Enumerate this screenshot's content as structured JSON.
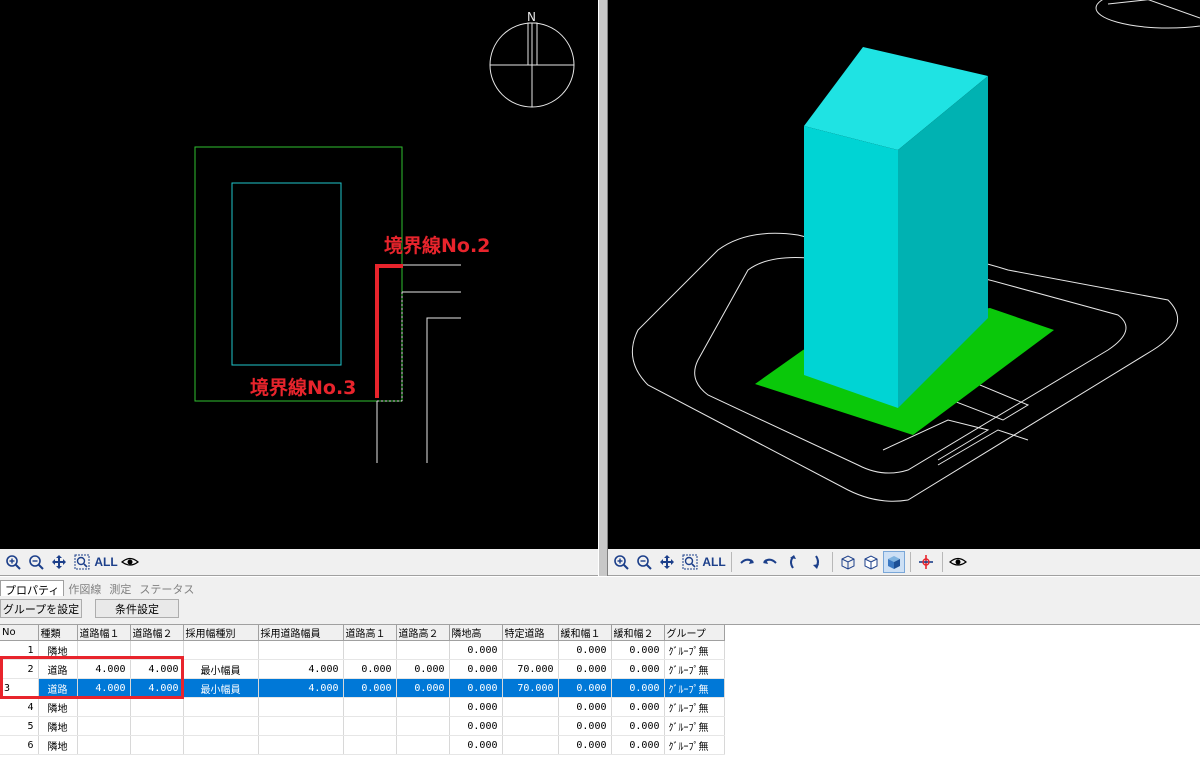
{
  "views": {
    "plan": {
      "compass_label": "N",
      "annotations": [
        {
          "text": "境界線No.2"
        },
        {
          "text": "境界線No.3"
        }
      ],
      "colors": {
        "site": "#2fbf2f",
        "building": "#1fc6cc",
        "highlight": "#e8242c",
        "line": "#e6e6e6"
      }
    },
    "perspective": {
      "colors": {
        "building_top": "#1fe3e3",
        "building_front": "#00d4d4",
        "building_side": "#00b2b2",
        "ground": "#0ac80a",
        "line": "#e6e6e6"
      }
    }
  },
  "toolbars": {
    "left": {
      "all_label": "ALL",
      "icons": [
        "zoom-in-icon",
        "zoom-out-icon",
        "pan-icon",
        "zoom-window-icon",
        "all-label",
        "view-eye-icon"
      ]
    },
    "right": {
      "all_label": "ALL",
      "icons": [
        "zoom-in-icon",
        "zoom-out-icon",
        "pan-icon",
        "zoom-window-icon",
        "all-label",
        "rotate-left-icon",
        "rotate-right-icon",
        "rotate-up-icon",
        "rotate-down-icon",
        "wireframe-icon",
        "hidden-line-icon",
        "shaded-icon",
        "axis-icon",
        "view-eye-icon"
      ]
    }
  },
  "panel": {
    "tabs": [
      {
        "label": "プロパティ",
        "active": true
      },
      {
        "label": "作図線",
        "active": false
      },
      {
        "label": "測定",
        "active": false
      },
      {
        "label": "ステータス",
        "active": false
      }
    ],
    "buttons": {
      "group": "グループを設定",
      "condition": "条件設定"
    },
    "columns": [
      "No",
      "種類",
      "道路幅１",
      "道路幅２",
      "採用幅種別",
      "採用道路幅員",
      "道路高１",
      "道路高２",
      "隣地高",
      "特定道路",
      "緩和幅１",
      "緩和幅２",
      "グループ"
    ],
    "rows": [
      [
        "1",
        "隣地",
        "",
        "",
        "",
        "",
        "",
        "",
        "0.000",
        "",
        "0.000",
        "0.000",
        "ｸﾞﾙｰﾌﾟ無"
      ],
      [
        "2",
        "道路",
        "4.000",
        "4.000",
        "最小幅員",
        "4.000",
        "0.000",
        "0.000",
        "0.000",
        "70.000",
        "0.000",
        "0.000",
        "ｸﾞﾙｰﾌﾟ無"
      ],
      [
        "3",
        "道路",
        "4.000",
        "4.000",
        "最小幅員",
        "4.000",
        "0.000",
        "0.000",
        "0.000",
        "70.000",
        "0.000",
        "0.000",
        "ｸﾞﾙｰﾌﾟ無"
      ],
      [
        "4",
        "隣地",
        "",
        "",
        "",
        "",
        "",
        "",
        "0.000",
        "",
        "0.000",
        "0.000",
        "ｸﾞﾙｰﾌﾟ無"
      ],
      [
        "5",
        "隣地",
        "",
        "",
        "",
        "",
        "",
        "",
        "0.000",
        "",
        "0.000",
        "0.000",
        "ｸﾞﾙｰﾌﾟ無"
      ],
      [
        "6",
        "隣地",
        "",
        "",
        "",
        "",
        "",
        "",
        "0.000",
        "",
        "0.000",
        "0.000",
        "ｸﾞﾙｰﾌﾟ無"
      ]
    ],
    "selected_row": 2
  }
}
